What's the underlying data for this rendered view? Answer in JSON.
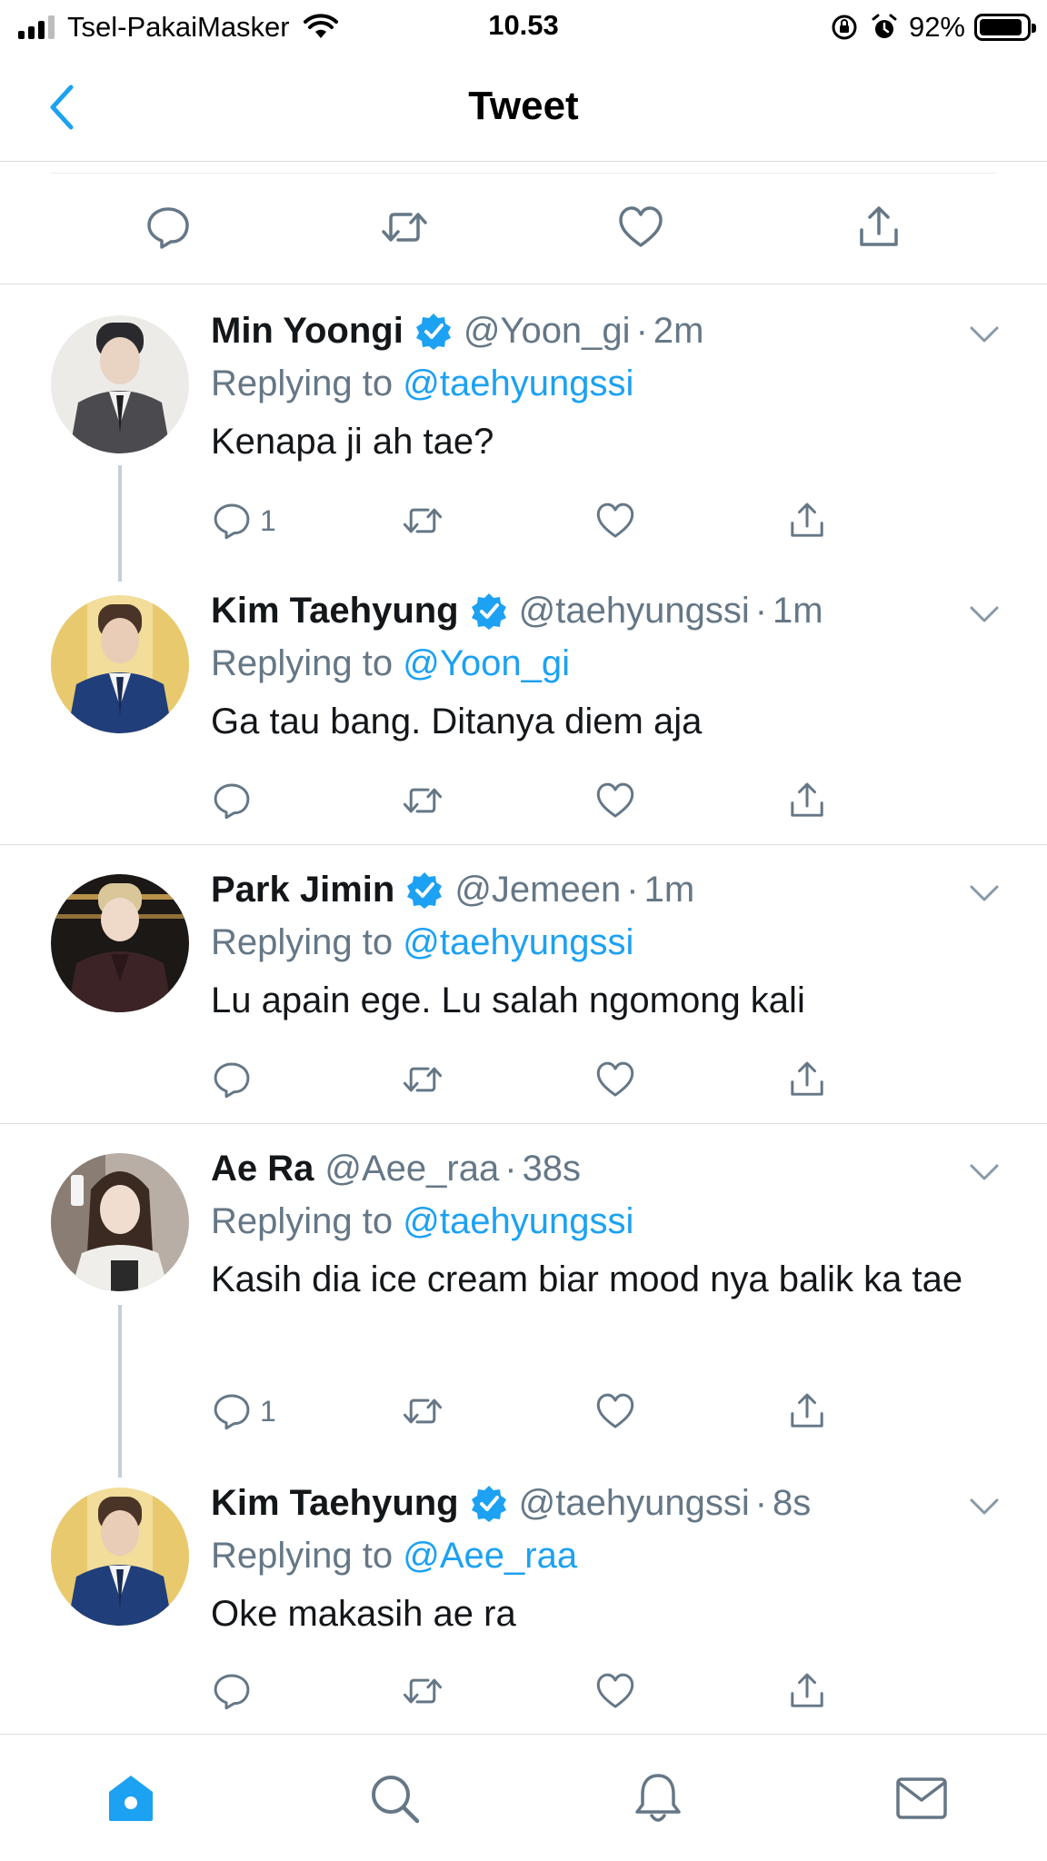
{
  "status_bar": {
    "carrier": "Tsel-PakaiMasker",
    "time": "10.53",
    "battery": "92%",
    "battery_level": 0.92
  },
  "nav": {
    "title": "Tweet",
    "back_icon": "chevron-left-icon"
  },
  "colors": {
    "accent": "#1da1f2",
    "text": "#14171a",
    "secondary": "#657786",
    "divider": "#d9dde1"
  },
  "main_actions": [
    "reply-icon",
    "retweet-icon",
    "like-icon",
    "share-icon"
  ],
  "tweets": [
    {
      "name": "Min Yoongi",
      "verified": true,
      "handle": "@Yoon_gi",
      "dot": "·",
      "time": "2m",
      "replying_prefix": "Replying to",
      "replying_to": "@taehyungssi",
      "text": "Kenapa ji ah tae?",
      "reply_count": "1"
    },
    {
      "name": "Kim Taehyung",
      "verified": true,
      "handle": "@taehyungssi",
      "dot": "·",
      "time": "1m",
      "replying_prefix": "Replying to",
      "replying_to": "@Yoon_gi",
      "text": "Ga tau bang. Ditanya diem aja",
      "reply_count": ""
    },
    {
      "name": "Park Jimin",
      "verified": true,
      "handle": "@Jemeen",
      "dot": "·",
      "time": "1m",
      "replying_prefix": "Replying to",
      "replying_to": "@taehyungssi",
      "text": "Lu apain ege. Lu salah ngomong kali",
      "reply_count": ""
    },
    {
      "name": "Ae Ra",
      "verified": false,
      "handle": "@Aee_raa",
      "dot": "·",
      "time": "38s",
      "replying_prefix": "Replying to",
      "replying_to": "@taehyungssi",
      "text": "Kasih dia ice cream biar mood nya balik ka tae",
      "reply_count": "1"
    },
    {
      "name": "Kim Taehyung",
      "verified": true,
      "handle": "@taehyungssi",
      "dot": "·",
      "time": "8s",
      "replying_prefix": "Replying to",
      "replying_to": "@Aee_raa",
      "text": "Oke makasih ae ra",
      "reply_count": ""
    }
  ],
  "tab_bar": [
    "home-icon",
    "search-icon",
    "notifications-icon",
    "messages-icon"
  ]
}
